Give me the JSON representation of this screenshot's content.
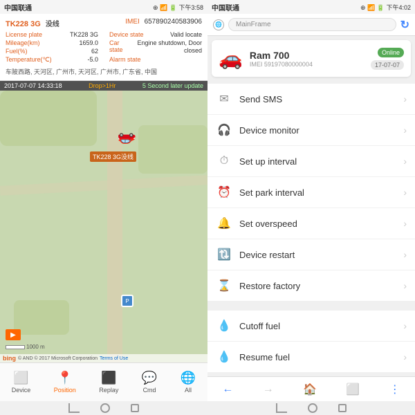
{
  "left": {
    "statusBar": {
      "carrier": "中国联通",
      "time": "下午3:58",
      "icons": "⊕ ▲ ▋▋▋ 🔋"
    },
    "infoPanel": {
      "deviceName": "TK228 3G",
      "deviceSub": "没线",
      "imeiLabel": "IMEI",
      "imeiValue": "657890240583906",
      "fields": [
        {
          "label": "License plate",
          "value": "TK228 3G"
        },
        {
          "label": "Mileage(km)",
          "value": "1659.0"
        },
        {
          "label": "Fuel(%)",
          "value": "62"
        },
        {
          "label": "Temperature(℃)",
          "value": "-5.0"
        },
        {
          "label": "Device state",
          "value": "Valid locate"
        },
        {
          "label": "Car state",
          "value": "Engine shutdown, Door closed"
        },
        {
          "label": "Alarm state",
          "value": ""
        }
      ],
      "address": "车陂西路, 天河区, 广州市, 天河区, 广州市, 广东省, 中国"
    },
    "mapBar": {
      "datetime": "2017-07-07 14:33:18",
      "drop": "Drop>1Hr",
      "update": "5 Second later update"
    },
    "carLabel": "TK228 3G没线",
    "copyright": "© AND © 2017 Microsoft Corporation Terms of Use",
    "scale": "1000 m",
    "toolbar": [
      {
        "id": "device",
        "label": "Device",
        "icon": "📦"
      },
      {
        "id": "position",
        "label": "Position",
        "icon": "📍",
        "active": true
      },
      {
        "id": "replay",
        "label": "Replay",
        "icon": "🎬"
      },
      {
        "id": "cmd",
        "label": "Cmd",
        "icon": "💻"
      },
      {
        "id": "all",
        "label": "All",
        "icon": "🌐"
      }
    ]
  },
  "right": {
    "statusBar": {
      "carrier": "中国联通",
      "time": "下午4:02",
      "icons": "⊕ ▲ ▋▋▋ 🔋"
    },
    "browserUrl": "MainFrame",
    "deviceCard": {
      "name": "Ram 700",
      "imei": "IMEI 59197080000004",
      "status": "Online",
      "date": "17-07-07"
    },
    "menuItems": [
      {
        "id": "send-sms",
        "icon": "✉",
        "label": "Send SMS"
      },
      {
        "id": "device-monitor",
        "icon": "🎧",
        "label": "Device monitor"
      },
      {
        "id": "set-interval",
        "icon": "⏱",
        "label": "Set up interval"
      },
      {
        "id": "park-interval",
        "icon": "⏰",
        "label": "Set park interval"
      },
      {
        "id": "overspeed",
        "icon": "🔔",
        "label": "Set overspeed"
      },
      {
        "id": "restart",
        "icon": "🔃",
        "label": "Device restart"
      },
      {
        "id": "restore",
        "icon": "⌛",
        "label": "Restore factory"
      },
      {
        "id": "cutoff-fuel",
        "icon": "💧",
        "label": "Cutoff fuel"
      },
      {
        "id": "resume-fuel",
        "icon": "💧",
        "label": "Resume fuel"
      }
    ]
  }
}
